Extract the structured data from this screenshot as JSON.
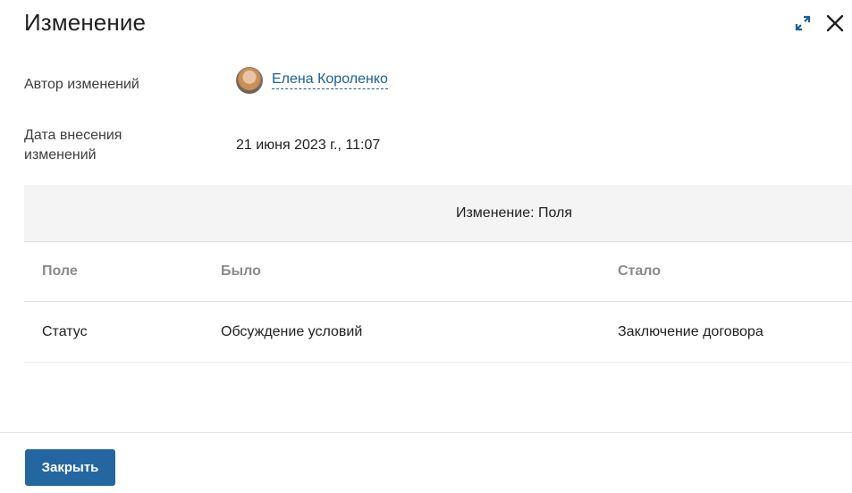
{
  "dialog": {
    "title": "Изменение",
    "icons": {
      "expand": "expand-icon",
      "close": "close-icon"
    },
    "accent_color": "#1a5f96"
  },
  "info": {
    "author_label": "Автор изменений",
    "author_name": "Елена Короленко",
    "date_label": "Дата внесения изменений",
    "date_value": "21 июня 2023 г., 11:07"
  },
  "changes": {
    "section_title": "Изменение: Поля",
    "columns": [
      "Поле",
      "Было",
      "Стало"
    ],
    "rows": [
      {
        "field": "Статус",
        "before": "Обсуждение условий",
        "after": "Заключение договора"
      }
    ]
  },
  "footer": {
    "close_label": "Закрыть",
    "button_color": "#2366a0"
  }
}
